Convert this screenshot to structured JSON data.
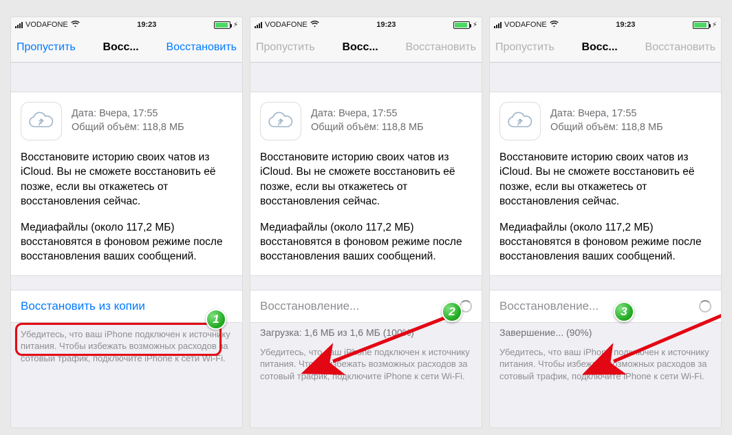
{
  "status": {
    "carrier": "VODAFONE",
    "wifi": "wifi-icon",
    "time": "19:23",
    "charging": "⚡︎"
  },
  "nav": {
    "skip": "Пропустить",
    "title": "Восс...",
    "restore": "Восстановить"
  },
  "info": {
    "date": "Дата: Вчера, 17:55",
    "size": "Общий объём: 118,8 МБ"
  },
  "body": {
    "p1": "Восстановите историю своих чатов из iCloud. Вы не сможете восстановить её позже, если вы откажетесь от восстановления сейчас.",
    "p2": "Медиафайлы (около 117,2 МБ) восстановятся в фоновом режиме после восстановления ваших сообщений."
  },
  "screen1": {
    "action": "Восстановить из копии",
    "hint": "Убедитесь, что ваш iPhone подключен к источнику питания. Чтобы избежать возможных расходов за сотовый трафик, подключите iPhone к сети Wi-Fi."
  },
  "screen2": {
    "action": "Восстановление...",
    "progress": "Загрузка: 1,6 МБ из 1,6 МБ (100%)",
    "hint": "Убедитесь, что ваш iPhone подключен к источнику питания. Чтобы избежать возможных расходов за сотовый трафик, подключите iPhone к сети Wi-Fi."
  },
  "screen3": {
    "action": "Восстановление...",
    "progress": "Завершение... (90%)",
    "hint": "Убедитесь, что ваш iPhone подключен к источнику питания. Чтобы избежать возможных расходов за сотовый трафик, подключите iPhone к сети Wi-Fi."
  },
  "badges": {
    "b1": "1",
    "b2": "2",
    "b3": "3"
  }
}
